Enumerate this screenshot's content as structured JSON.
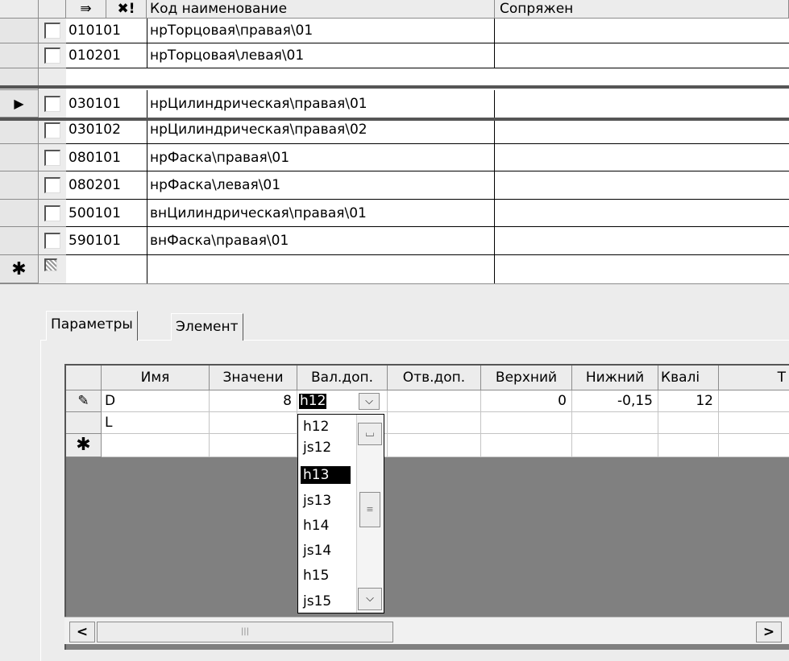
{
  "top_grid": {
    "toolbar_icons": [
      "arrow-right-icon",
      "delete-icon"
    ],
    "toolbar_icon_glyphs": [
      "⇛",
      "✖!"
    ],
    "columns": [
      "Код наименование",
      "Сопряжен"
    ],
    "rows": [
      {
        "code": "010101",
        "name": "нрТорцовая\\правая\\01",
        "mated": ""
      },
      {
        "code": "010201",
        "name": "нрТорцовая\\левая\\01",
        "mated": ""
      },
      {
        "code": "030101",
        "name": "нрЦилиндрическая\\правая\\01",
        "mated": ""
      },
      {
        "code": "030102",
        "name": "нрЦилиндрическая\\правая\\02",
        "mated": ""
      },
      {
        "code": "080101",
        "name": "нрФаска\\правая\\01",
        "mated": ""
      },
      {
        "code": "080201",
        "name": "нрФаска\\левая\\01",
        "mated": ""
      },
      {
        "code": "500101",
        "name": "внЦилиндрическая\\правая\\01",
        "mated": ""
      },
      {
        "code": "590101",
        "name": "внФаска\\правая\\01",
        "mated": ""
      }
    ],
    "new_row_marker": "✱",
    "current_row_marker": "▶"
  },
  "tabs": [
    {
      "label": "Параметры",
      "active": true
    },
    {
      "label": "Элемент",
      "active": false
    }
  ],
  "params_grid": {
    "columns": [
      "Имя",
      "Значени",
      "Вал.доп.",
      "Отв.доп.",
      "Верхний",
      "Нижний",
      "Квалі",
      "Т"
    ],
    "rows": [
      {
        "marker": "✎",
        "name": "D",
        "value": "8",
        "shaft_tol": "h12",
        "hole_tol": "",
        "upper": "0",
        "lower": "-0,15",
        "grade": "12"
      },
      {
        "marker": "",
        "name": "L",
        "value": "",
        "shaft_tol": "",
        "hole_tol": "",
        "upper": "",
        "lower": "",
        "grade": ""
      }
    ],
    "new_row_marker": "✱"
  },
  "dropdown": {
    "current": "h12",
    "options": [
      "h12",
      "js12",
      "h13",
      "js13",
      "h14",
      "js14",
      "h15",
      "js15"
    ],
    "highlighted": "h13"
  },
  "scrollbar": {
    "left_arrow": "<",
    "right_arrow": ">",
    "thumb_grip": "|||"
  }
}
